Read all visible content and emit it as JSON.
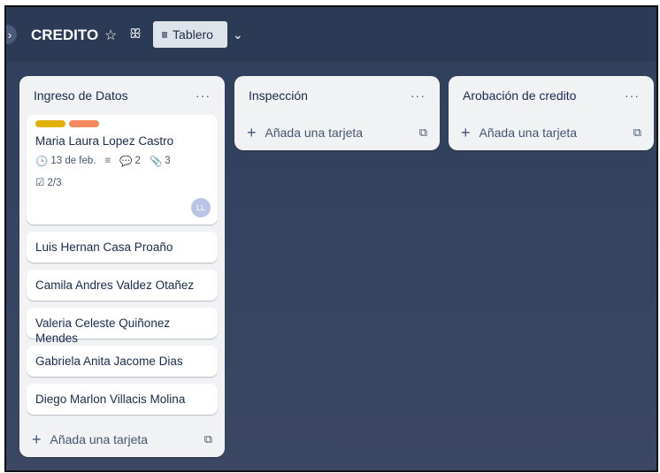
{
  "board": {
    "title": "CREDITO",
    "view_label": "Tablero",
    "icons": [
      "star-icon",
      "people-icon",
      "board-icon",
      "chevron-down-icon"
    ]
  },
  "lists": [
    {
      "title": "Ingreso de Datos",
      "more": "···",
      "detail_card": {
        "label_colors": [
          "#e2b203",
          "#f38a5d"
        ],
        "title": "Maria Laura Lopez Castro",
        "due": "13 de feb.",
        "comments": "2",
        "attachments": "3",
        "checklist": "2/3",
        "avatar": "LL"
      },
      "cards": [
        "Luis Hernan Casa Proaño",
        "Camila Andres Valdez Otañez",
        "Valeria Celeste Quiñonez Mendes",
        "Gabriela Anita Jacome Dias",
        "Diego Marlon Villacis Molina"
      ],
      "add_label": "Añada una tarjeta"
    },
    {
      "title": "Inspección",
      "more": "···",
      "add_label": "Añada una tarjeta"
    },
    {
      "title": "Arobación de credito",
      "more": "···",
      "add_label": "Añada una tarjeta"
    }
  ]
}
